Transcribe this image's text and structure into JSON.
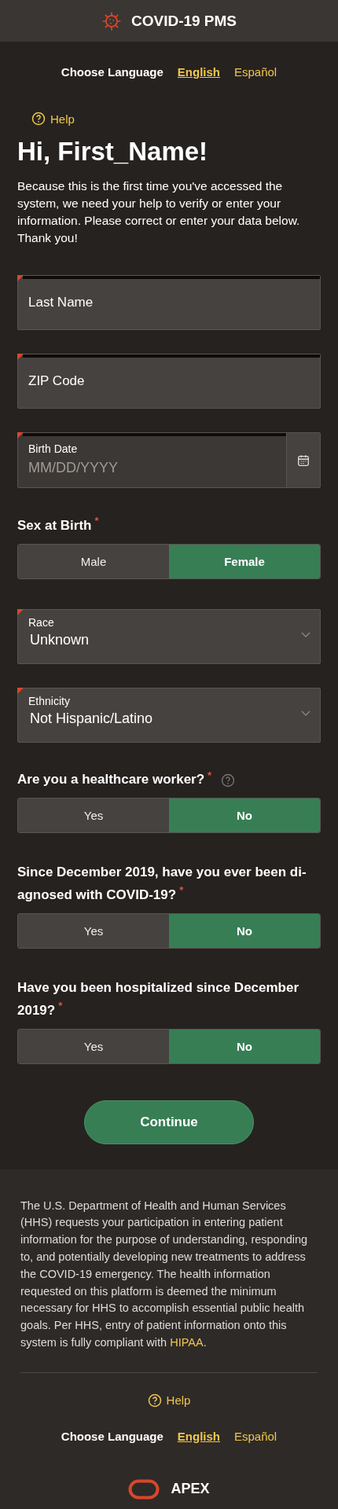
{
  "header": {
    "title": "COVID-19 PMS"
  },
  "language_top": {
    "label": "Choose Language",
    "options": [
      {
        "label": "English",
        "selected": true
      },
      {
        "label": "Español",
        "selected": false
      }
    ]
  },
  "help_top": {
    "label": "Help"
  },
  "greeting": "Hi, First_Name!",
  "intro": "Because this is the first time you've accessed the system, we need your help to verify or enter your information. Please correct or enter your data below. Thank you!",
  "fields": [
    {
      "kind": "text",
      "label": "Last Name",
      "required": true
    },
    {
      "kind": "text",
      "label": "ZIP Code",
      "required": true
    },
    {
      "kind": "date",
      "label": "Birth Date",
      "placeholder": "MM/DD/YYYY",
      "required": true
    },
    {
      "kind": "choice",
      "label": "Sex at Birth",
      "asterisk": "*",
      "options": [
        {
          "label": "Male",
          "selected": false
        },
        {
          "label": "Female",
          "selected": true
        }
      ]
    },
    {
      "kind": "select",
      "label": "Race",
      "value": "Unknown",
      "required": true
    },
    {
      "kind": "select",
      "label": "Ethnicity",
      "value": "Not Hispanic/Latino",
      "required": true
    },
    {
      "kind": "choice",
      "label": "Are you a healthcare worker?",
      "asterisk": "*",
      "help": true,
      "options": [
        {
          "label": "Yes",
          "selected": false
        },
        {
          "label": "No",
          "selected": true
        }
      ]
    },
    {
      "kind": "choice",
      "label": "Since December 2019, have you ever been di-agnosed with COVID-19?",
      "asterisk": "*",
      "options": [
        {
          "label": "Yes",
          "selected": false
        },
        {
          "label": "No",
          "selected": true
        }
      ]
    },
    {
      "kind": "choice",
      "label": "Have you been hospitalized since December 2019?",
      "asterisk": "*",
      "options": [
        {
          "label": "Yes",
          "selected": false
        },
        {
          "label": "No",
          "selected": true
        }
      ]
    }
  ],
  "continue_button": "Continue",
  "footer": {
    "notice": "The U.S. Department of Health and Human Services (HHS) requests your participation in entering patient information for the purpose of understanding, responding to, and potentially developing new treatments to address the COVID-19 emergency. The health information requested on this platform is deemed the minimum necessary for HHS to accomplish essential public health goals. Per HHS, entry of patient information onto this system is fully compliant with ",
    "notice_link": "HIPAA",
    "notice_end": ".",
    "help": {
      "label": "Help"
    },
    "language": {
      "label": "Choose Language",
      "options": [
        {
          "label": "English",
          "selected": true
        },
        {
          "label": "Español",
          "selected": false
        }
      ]
    },
    "brand": "APEX"
  }
}
